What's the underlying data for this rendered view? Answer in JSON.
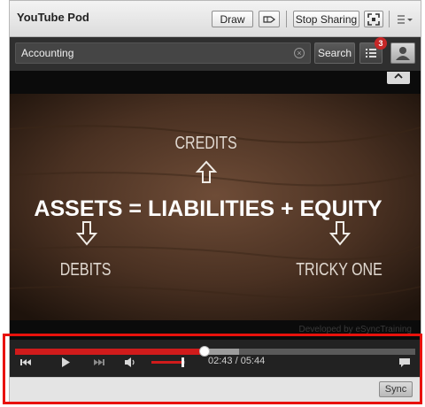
{
  "pod": {
    "title": "YouTube Pod"
  },
  "toolbar": {
    "draw_label": "Draw",
    "stop_sharing_label": "Stop Sharing"
  },
  "search": {
    "value": "Accounting",
    "button_label": "Search",
    "clear_symbol": "×"
  },
  "playlist": {
    "badge_count": "3"
  },
  "video": {
    "center_line": "ASSETS = LIABILITIES + EQUITY",
    "label_top": "CREDITS",
    "label_left": "DEBITS",
    "label_right": "TRICKY ONE",
    "credit_text": "Developed by eSyncTraining"
  },
  "player": {
    "time": "02:43 / 05:44",
    "progress_fraction": 0.473,
    "buffered_fraction": 0.56,
    "volume_fraction": 0.9
  },
  "footer": {
    "sync_label": "Sync"
  },
  "colors": {
    "highlight": "#e8120c",
    "progress": "#d01b1b",
    "badge": "#c62828"
  },
  "icons": [
    "pointer-icon",
    "fullscreen-icon",
    "menu-icon",
    "list-icon",
    "user-icon",
    "chevron-up-icon",
    "skip-back-icon",
    "play-icon",
    "skip-forward-icon",
    "volume-icon",
    "chat-icon"
  ]
}
